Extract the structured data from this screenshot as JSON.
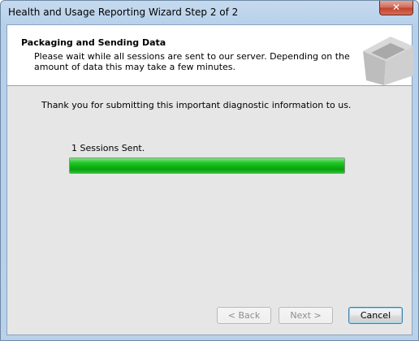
{
  "window": {
    "title": "Health and Usage Reporting Wizard Step 2 of 2",
    "close_glyph": "✕"
  },
  "header": {
    "title": "Packaging and Sending Data",
    "description": "Please wait while all sessions are sent to our server.  Depending on the amount of data this may take a few minutes.",
    "graphic_icon": "box-icon"
  },
  "body": {
    "thank_you": "Thank you for submitting this important diagnostic information to us.",
    "sessions_status": "1 Sessions Sent.",
    "progress_fraction": 1.0,
    "progress_color": "#14b619"
  },
  "buttons": {
    "back": "< Back",
    "next": "Next >",
    "cancel": "Cancel"
  }
}
